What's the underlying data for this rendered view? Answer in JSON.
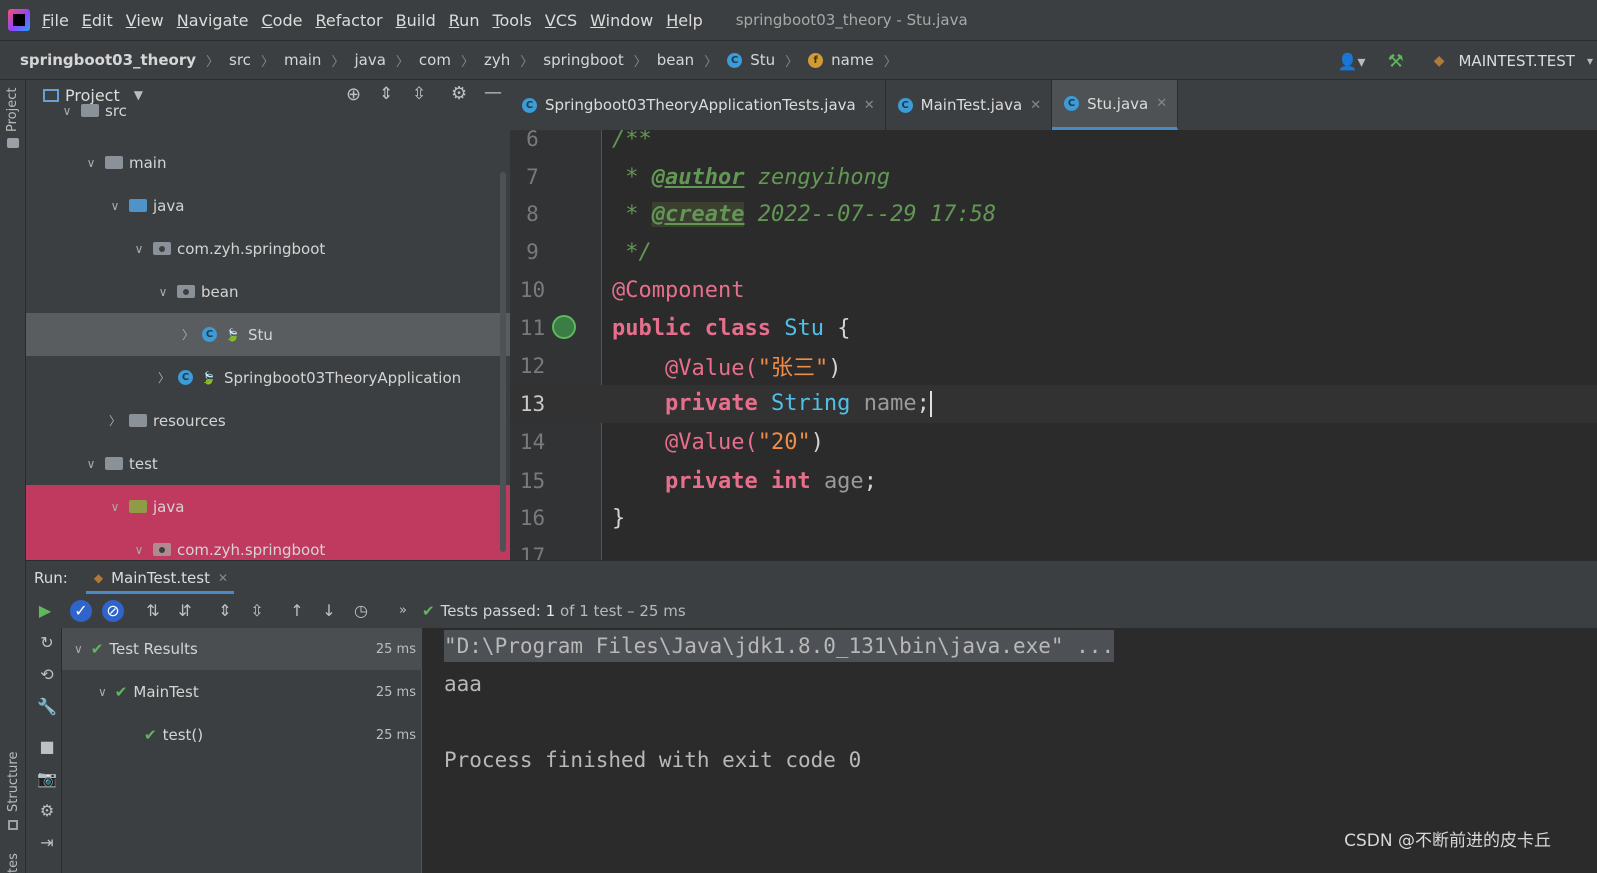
{
  "menu": {
    "items": [
      {
        "u": "F",
        "rest": "ile"
      },
      {
        "u": "E",
        "rest": "dit"
      },
      {
        "u": "V",
        "rest": "iew"
      },
      {
        "u": "N",
        "rest": "avigate"
      },
      {
        "u": "C",
        "rest": "ode"
      },
      {
        "u": "R",
        "rest": "efactor"
      },
      {
        "u": "B",
        "rest": "uild"
      },
      {
        "u": "R",
        "rest": "un"
      },
      {
        "u": "T",
        "rest": "ools"
      },
      {
        "u": "V",
        "rest": "CS"
      },
      {
        "u": "W",
        "rest": "indow"
      },
      {
        "u": "H",
        "rest": "elp"
      }
    ],
    "window_title": "springboot03_theory - Stu.java"
  },
  "breadcrumb": {
    "items": [
      "springboot03_theory",
      "src",
      "main",
      "java",
      "com",
      "zyh",
      "springboot",
      "bean",
      "Stu",
      "name"
    ],
    "run_config": "MAINTEST.TEST"
  },
  "stripe": {
    "project": "Project",
    "structure": "Structure",
    "favorites": "tes"
  },
  "project": {
    "title": "Project",
    "tree": [
      "src",
      "main",
      "java",
      "com.zyh.springboot",
      "bean",
      "Stu",
      "Springboot03TheoryApplication",
      "resources",
      "test",
      "java",
      "com.zyh.springboot"
    ]
  },
  "tabs": [
    {
      "label": "Springboot03TheoryApplicationTests.java"
    },
    {
      "label": "MainTest.java"
    },
    {
      "label": "Stu.java"
    }
  ],
  "editor": {
    "line_numbers": [
      "6",
      "7",
      "8",
      "9",
      "10",
      "11",
      "12",
      "13",
      "14",
      "15",
      "16",
      "17"
    ],
    "current_line": "13",
    "lines": {
      "l6": "/**",
      "l7_a": " * ",
      "l7_tag": "@author",
      "l7_b": " zengyihong",
      "l8_a": " * ",
      "l8_tag": "@create",
      "l8_b": " 2022--07--29 17:58",
      "l9": " */",
      "l10": "@Component",
      "l11_kw": "public class",
      "l11_cls": "Stu",
      "l11_b": " {",
      "l12_ann": "@Value(",
      "l12_str": "\"张三\"",
      "l12_b": ")",
      "l13_kw": "private",
      "l13_type": "String",
      "l13_field": "name",
      "l13_b": ";",
      "l14_ann": "@Value(",
      "l14_str": "\"20\"",
      "l14_b": ")",
      "l15_kw": "private int",
      "l15_field": "age",
      "l15_b": ";",
      "l16": "}"
    }
  },
  "run": {
    "label": "Run:",
    "tab": "MainTest.test",
    "status_prefix": "Tests passed:",
    "status_count": "1",
    "status_rest": "of 1 test – 25 ms",
    "tests": [
      {
        "name": "Test Results",
        "time": "25 ms"
      },
      {
        "name": "MainTest",
        "time": "25 ms"
      },
      {
        "name": "test()",
        "time": "25 ms"
      }
    ],
    "console": [
      "\"D:\\Program Files\\Java\\jdk1.8.0_131\\bin\\java.exe\" ...",
      "aaa",
      "Process finished with exit code 0"
    ]
  },
  "watermark": "CSDN @不断前进的皮卡丘",
  "colors": {
    "accent": "#4a88c7",
    "selection": "#c0395e",
    "ok": "#5fb85b"
  }
}
